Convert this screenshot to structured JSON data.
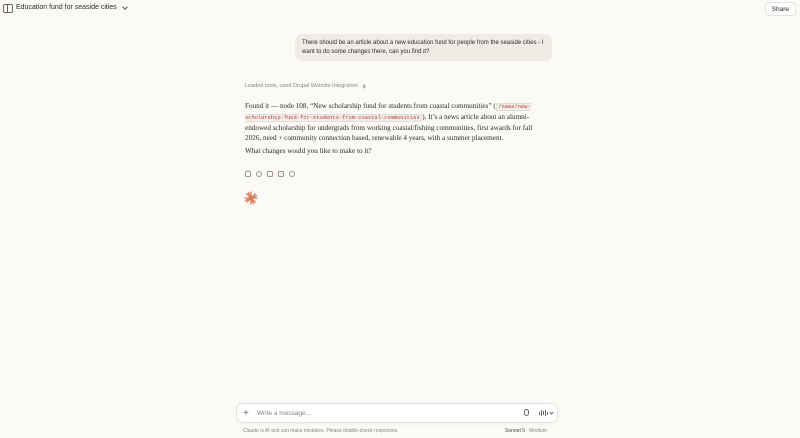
{
  "header": {
    "conversation_title": "Education fund for seaside cities",
    "share_label": "Share"
  },
  "user_message": {
    "text": "There should be an article about a new education fund for people from the seaside cities - I want to do some changes there, can you find it?"
  },
  "tools_line": "Loaded tools, used Drupal Website Integration",
  "reply": {
    "p1_before_code": "Found it — node 108, “New scholarship fund for students from coastal communities” (",
    "code": "/news/new-scholarship-fund-for-students-from-coastal-communities",
    "p1_after_code": "). It’s a news article about an alumni-endowed scholarship for undergrads from working coastal/fishing communities, first awards for fall 2026, need + community connection based, renewable 4 years, with a summer placement.",
    "p2": "What changes would you like to make to it?"
  },
  "composer": {
    "placeholder": "Write a message..."
  },
  "footer": {
    "disclaimer": "Claude is AI and can make mistakes. Please double-check responses.",
    "model": "Sonnet 5",
    "level": "Medium"
  },
  "colors": {
    "background": "#fbfaf7",
    "user_bubble": "#efece5",
    "code_text": "#b8433b",
    "spark": "#d97757"
  },
  "icons": [
    "sidebar-toggle-icon",
    "chevron-down-icon",
    "copy-icon",
    "regenerate-icon",
    "thumbs-up-icon",
    "thumbs-down-icon",
    "retry-icon",
    "claude-spark-icon",
    "plus-icon",
    "microphone-icon",
    "voice-mode-icon"
  ]
}
